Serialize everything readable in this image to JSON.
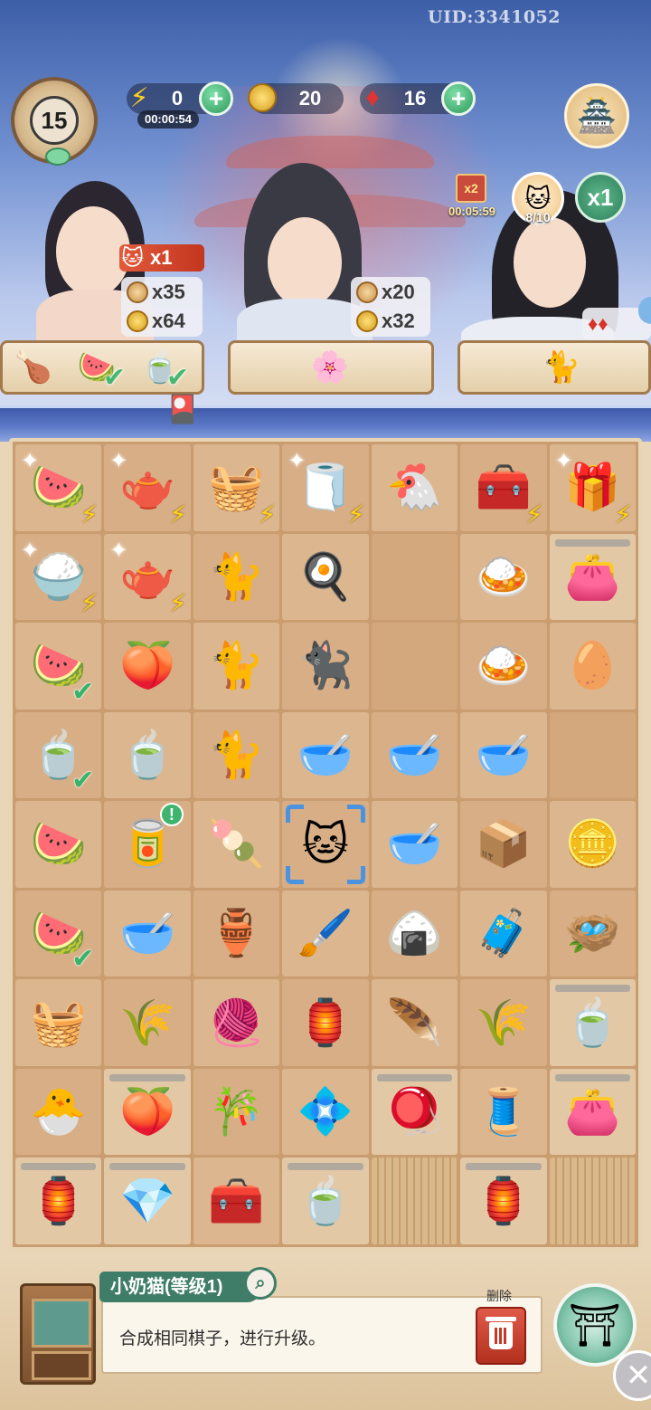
{
  "header": {
    "uid": "UID:3341052",
    "level": "15",
    "energy": {
      "value": "0",
      "timer": "00:00:54",
      "icon": "lightning-icon"
    },
    "coins": {
      "value": "20",
      "icon": "coin-icon"
    },
    "gems": {
      "value": "16",
      "icon": "ruby-icon"
    },
    "plus_label": "+"
  },
  "boosts": {
    "double_card_label": "x2",
    "double_timer": "00:05:59",
    "cat_progress": "8/10",
    "multiplier": "x1"
  },
  "customers": [
    {
      "name": "girl",
      "cat_tag": "x1",
      "rewards": {
        "cookies": "x35",
        "coins": "x64"
      },
      "orders": [
        {
          "icon": "🍗",
          "done": false
        },
        {
          "icon": "🍉",
          "done": true
        },
        {
          "icon": "🍵",
          "done": true
        }
      ]
    },
    {
      "name": "scholar",
      "rewards": {
        "cookies": "x20",
        "coins": "x32"
      },
      "orders": [
        {
          "icon": "🌸",
          "done": false
        }
      ]
    },
    {
      "name": "swordsman",
      "orders": [
        {
          "icon": "🐈",
          "done": false
        }
      ]
    }
  ],
  "board": [
    [
      {
        "i": "🍉",
        "b": true,
        "s": true
      },
      {
        "i": "🫖",
        "b": true,
        "s": true
      },
      {
        "i": "🧺",
        "b": true
      },
      {
        "i": "🧻",
        "b": true,
        "s": true
      },
      {
        "i": "🐔",
        "b": false
      },
      {
        "i": "🧰",
        "b": true
      },
      {
        "i": "🎁",
        "b": true,
        "s": true
      }
    ],
    [
      {
        "i": "🍚",
        "b": true,
        "s": true
      },
      {
        "i": "🫖",
        "b": true,
        "s": true
      },
      {
        "i": "🐈"
      },
      {
        "i": "🍳"
      },
      {
        "i": ""
      },
      {
        "i": "🍛"
      },
      {
        "i": "👛",
        "lock": true
      }
    ],
    [
      {
        "i": "🍉",
        "ok": true
      },
      {
        "i": "🍑"
      },
      {
        "i": "🐈"
      },
      {
        "i": "🐈‍⬛"
      },
      {
        "i": ""
      },
      {
        "i": "🍛"
      },
      {
        "i": "🥚"
      }
    ],
    [
      {
        "i": "🍵",
        "ok": true
      },
      {
        "i": "🍵"
      },
      {
        "i": "🐈"
      },
      {
        "i": "🥣"
      },
      {
        "i": "🥣"
      },
      {
        "i": "🥣"
      },
      {
        "i": ""
      }
    ],
    [
      {
        "i": "🍉"
      },
      {
        "i": "🥫",
        "alert": true
      },
      {
        "i": "🍡"
      },
      {
        "i": "🐱",
        "sel": true
      },
      {
        "i": "🥣"
      },
      {
        "i": "📦"
      },
      {
        "i": "🪙"
      }
    ],
    [
      {
        "i": "🍉",
        "ok": true
      },
      {
        "i": "🥣"
      },
      {
        "i": "🏺"
      },
      {
        "i": "🖌️"
      },
      {
        "i": "🍙"
      },
      {
        "i": "🧳"
      },
      {
        "i": "🪺"
      }
    ],
    [
      {
        "i": "🧺"
      },
      {
        "i": "🌾"
      },
      {
        "i": "🧶"
      },
      {
        "i": "🏮"
      },
      {
        "i": "🪶"
      },
      {
        "i": "🌾"
      },
      {
        "i": "🍵",
        "lock": true
      }
    ],
    [
      {
        "i": "🐣"
      },
      {
        "i": "🍑",
        "lock": true
      },
      {
        "i": "🎋"
      },
      {
        "i": "💠"
      },
      {
        "i": "🪀",
        "lock": true
      },
      {
        "i": "🧵"
      },
      {
        "i": "👛",
        "lock": true
      }
    ],
    [
      {
        "i": "🏮",
        "lock": true
      },
      {
        "i": "💎",
        "lock": true
      },
      {
        "i": "🧰"
      },
      {
        "i": "🍵",
        "lock": true
      },
      {
        "i": "",
        "blind": true
      },
      {
        "i": "🏮",
        "lock": true
      },
      {
        "i": "",
        "blind": true
      }
    ]
  ],
  "info": {
    "item_name": "小奶猫(等级1)",
    "description": "合成相同棋子，进行升级。",
    "delete_label": "删除"
  },
  "colors": {
    "accent_green": "#3f7d68",
    "board_bg": "#c99d70",
    "selection_blue": "#4a93e0"
  }
}
